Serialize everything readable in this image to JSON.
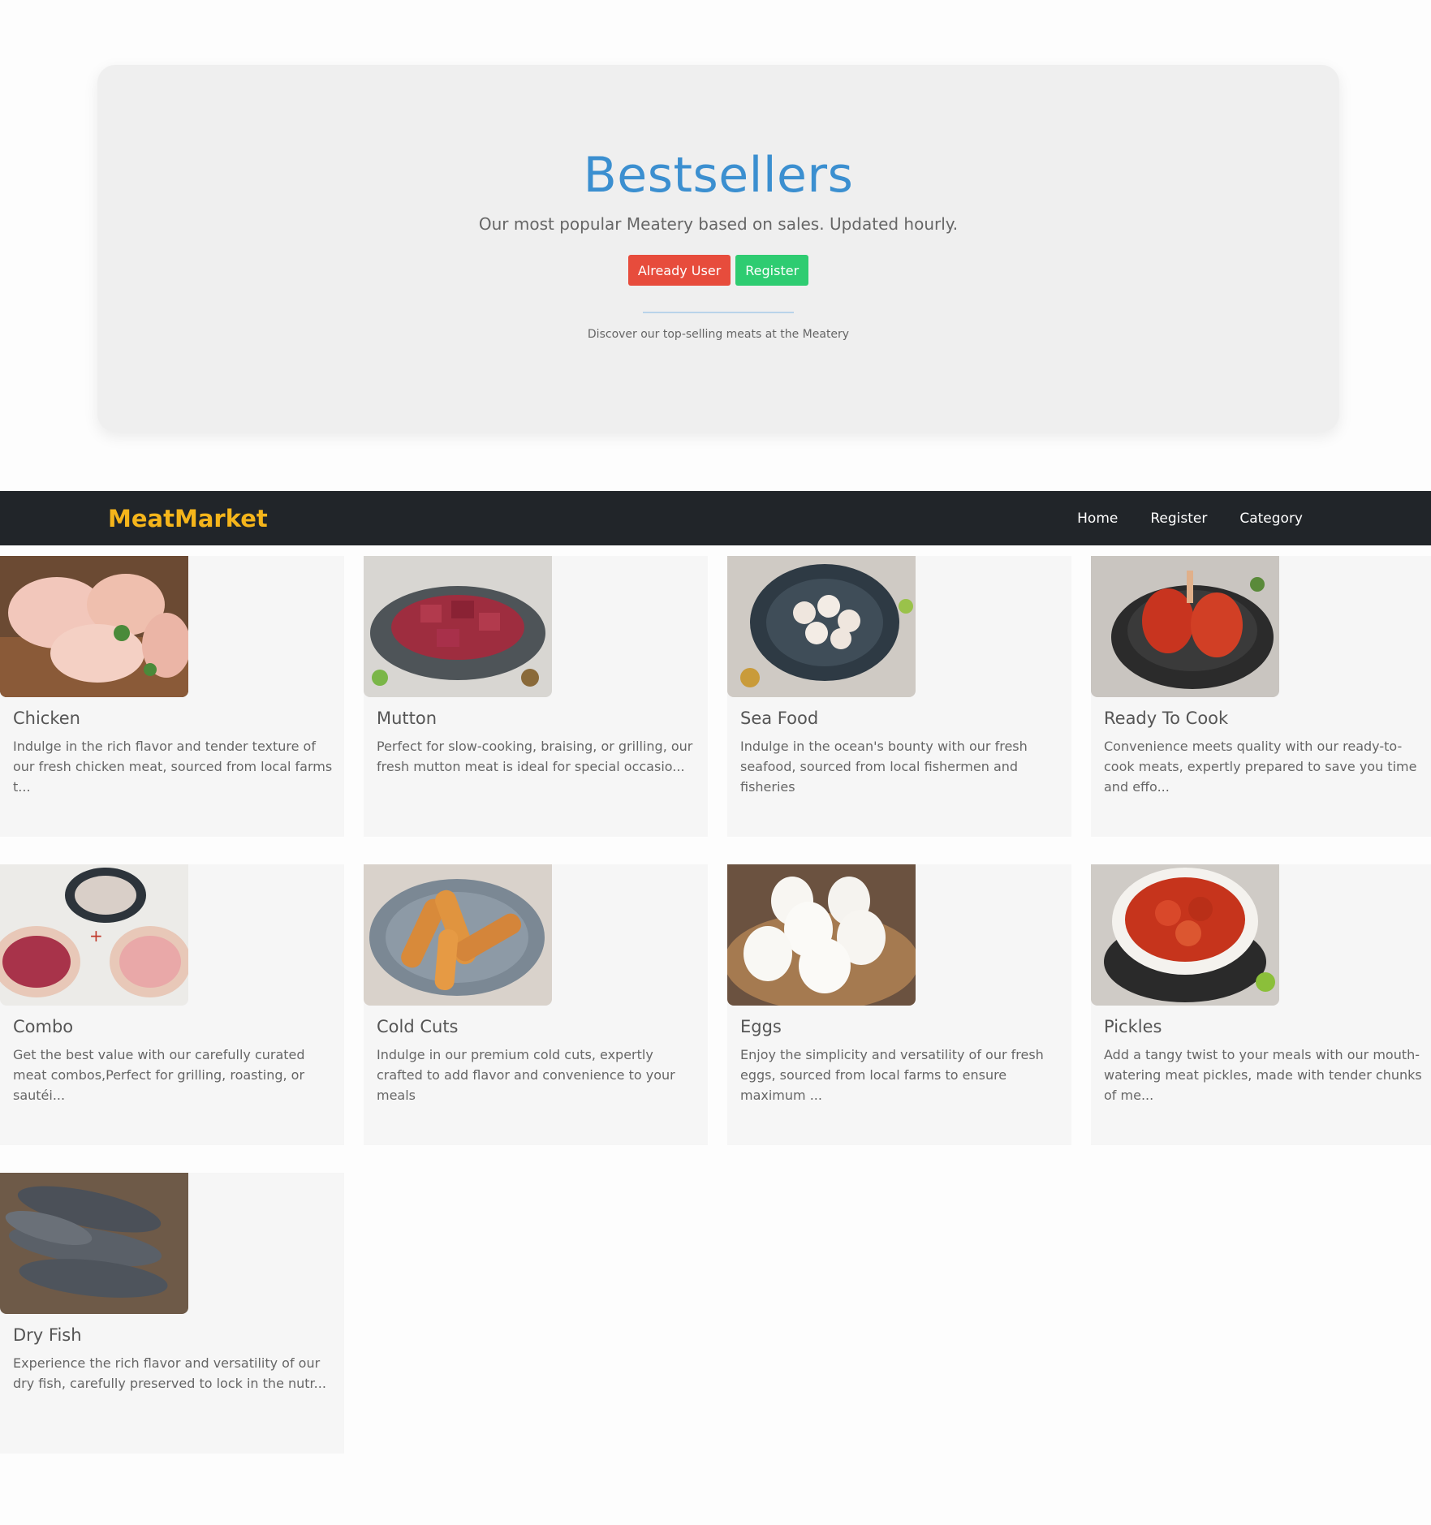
{
  "hero": {
    "title": "Bestsellers",
    "subtitle": "Our most popular Meatery based on sales. Updated hourly.",
    "buttons": {
      "already_user": "Already User",
      "register": "Register"
    },
    "note": "Discover our top-selling meats at the Meatery"
  },
  "navbar": {
    "brand": "MeatMarket",
    "links": [
      "Home",
      "Register",
      "Category"
    ]
  },
  "products": [
    {
      "title": "Chicken",
      "desc": "Indulge in the rich flavor and tender texture of our fresh chicken meat, sourced from local farms t...",
      "image": "chicken-image"
    },
    {
      "title": "Mutton",
      "desc": "Perfect for slow-cooking, braising, or grilling, our fresh mutton meat is ideal for special occasio...",
      "image": "mutton-image"
    },
    {
      "title": "Sea Food",
      "desc": "Indulge in the ocean's bounty with our fresh seafood, sourced from local fishermen and fisheries",
      "image": "seafood-image"
    },
    {
      "title": "Ready To Cook",
      "desc": "Convenience meets quality with our ready-to-cook meats, expertly prepared to save you time and effo...",
      "image": "ready-to-cook-image"
    },
    {
      "title": "Combo",
      "desc": "Get the best value with our carefully curated meat combos,Perfect for grilling, roasting, or sautéi...",
      "image": "combo-image"
    },
    {
      "title": "Cold Cuts",
      "desc": "Indulge in our premium cold cuts, expertly crafted to add flavor and convenience to your meals",
      "image": "cold-cuts-image"
    },
    {
      "title": "Eggs",
      "desc": "Enjoy the simplicity and versatility of our fresh eggs, sourced from local farms to ensure maximum ...",
      "image": "eggs-image"
    },
    {
      "title": "Pickles",
      "desc": "Add a tangy twist to your meals with our mouth-watering meat pickles, made with tender chunks of me...",
      "image": "pickles-image"
    },
    {
      "title": "Dry Fish",
      "desc": "Experience the rich flavor and versatility of our dry fish, carefully preserved to lock in the nutr...",
      "image": "dry-fish-image"
    }
  ],
  "colors": {
    "hero_title": "#3b8fd0",
    "btn_red": "#e74c3c",
    "btn_green": "#2ecc71",
    "navbar_bg": "#212529",
    "brand": "#f5b51b"
  }
}
